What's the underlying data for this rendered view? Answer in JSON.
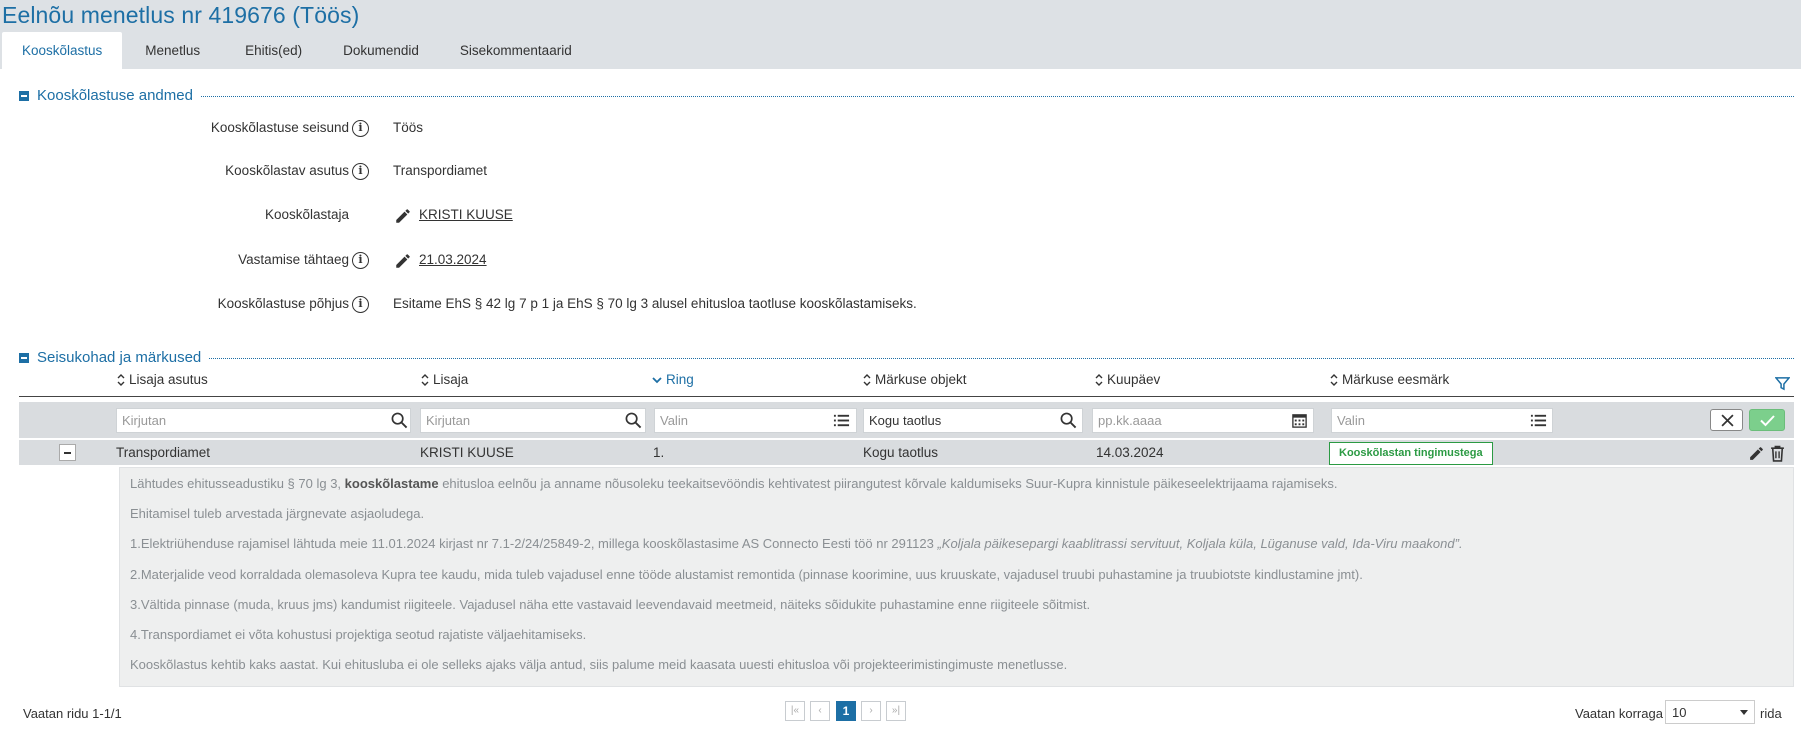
{
  "page": {
    "title": "Eelnõu menetlus nr 419676 (Töös)"
  },
  "tabs": [
    {
      "label": "Kooskõlastus",
      "active": true
    },
    {
      "label": "Menetlus",
      "active": false
    },
    {
      "label": "Ehitis(ed)",
      "active": false
    },
    {
      "label": "Dokumendid",
      "active": false
    },
    {
      "label": "Sisekommentaarid",
      "active": false
    }
  ],
  "approval_section": {
    "title": "Kooskõlastuse andmed",
    "fields": [
      {
        "label": "Kooskõlastuse seisund",
        "value": "Töös"
      },
      {
        "label": "Kooskõlastav asutus",
        "value": "Transpordiamet"
      },
      {
        "label": "Kooskõlastaja",
        "value": "KRISTI KUUSE"
      },
      {
        "label": "Vastamise tähtaeg",
        "value": "21.03.2024"
      },
      {
        "label": "Kooskõlastuse põhjus",
        "value": "Esitame EhS § 42 lg 7 p 1 ja EhS § 70 lg 3 alusel ehitusloa taotluse kooskõlastamiseks."
      }
    ]
  },
  "comments_section": {
    "title": "Seisukohad ja märkused",
    "columns": [
      "Lisaja asutus",
      "Lisaja",
      "Ring",
      "Märkuse objekt",
      "Kuupäev",
      "Märkuse eesmärk"
    ],
    "filters": [
      {
        "value": "",
        "placeholder": "Kirjutan"
      },
      {
        "value": "",
        "placeholder": "Kirjutan"
      },
      {
        "value": "",
        "placeholder": "Valin"
      },
      {
        "value": "Kogu taotlus",
        "placeholder": ""
      },
      {
        "value": "",
        "placeholder": "pp.kk.aaaa"
      },
      {
        "value": "",
        "placeholder": "Valin"
      }
    ],
    "row": {
      "agency": "Transpordiamet",
      "author": "KRISTI KUUSE",
      "round": "1.",
      "object": "Kogu taotlus",
      "date": "14.03.2024",
      "purpose": "Kooskõlastan tingimustega"
    },
    "detail": {
      "p1_before": "Lähtudes ehitusseadustiku § 70 lg 3, ",
      "p1_bold": "kooskõlastame",
      "p1_after": " ehitusloa eelnõu ja anname nõusoleku teekaitsevööndis kehtivatest piirangutest kõrvale kaldumiseks Suur-Kupra kinnistule päikeseelektrijaama rajamiseks.",
      "p2": "Ehitamisel tuleb arvestada järgnevate asjaoludega.",
      "p3_before": "1.Elektriühenduse rajamisel lähtuda meie 11.01.2024 kirjast nr 7.1-2/24/25849-2, millega kooskõlastasime AS Connecto Eesti töö nr 291123 ",
      "p3_italic": "„Koljala päikesepargi kaablitrassi servituut, Koljala küla, Lüganuse vald, Ida-Viru maakond”.",
      "p4": "2.Materjalide veod korraldada olemasoleva Kupra tee kaudu, mida tuleb vajadusel enne tööde alustamist remontida (pinnase koorimine, uus kruuskate, vajadusel truubi puhastamine ja truubiotste kindlustamine jmt).",
      "p5": "3.Vältida pinnase (muda, kruus jms) kandumist riigiteele. Vajadusel näha ette vastavaid leevendavaid meetmeid, näiteks sõidukite puhastamine enne riigiteele sõitmist.",
      "p6": "4.Transpordiamet ei võta kohustusi projektiga seotud rajatiste väljaehitamiseks.",
      "p7": "Kooskõlastus kehtib kaks aastat. Kui ehitusluba ei ole selleks ajaks välja antud, siis palume meid kaasata uuesti ehitusloa või projekteerimistingimuste menetlusse."
    }
  },
  "footer": {
    "rows_info": "Vaatan ridu 1-1/1",
    "current_page": "1",
    "page_size_label": "Vaatan korraga",
    "page_size": "10",
    "rows_suffix": "rida"
  }
}
